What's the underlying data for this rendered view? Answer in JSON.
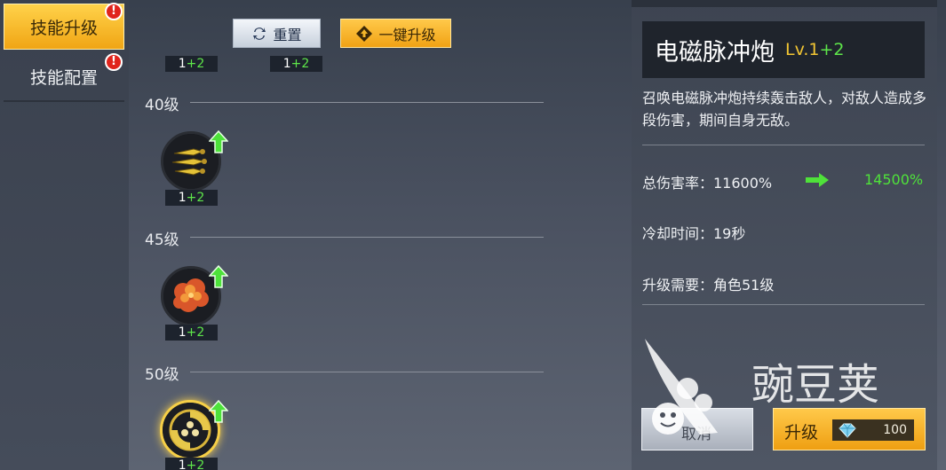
{
  "tabs": [
    {
      "label": "技能升级",
      "active": true,
      "alert": "!"
    },
    {
      "label": "技能配置",
      "active": false,
      "alert": "!"
    }
  ],
  "toolbar": {
    "reset_label": "重置",
    "oneclick_label": "一键升级"
  },
  "top_tags": [
    {
      "base": "1",
      "bonus": "+2"
    },
    {
      "base": "1",
      "bonus": "+2"
    }
  ],
  "rows": [
    {
      "level": "40级",
      "skill": {
        "base": "1",
        "bonus": "+2",
        "selected": false,
        "upgradable": true,
        "icon": "triple-bullet-icon"
      }
    },
    {
      "level": "45级",
      "skill": {
        "base": "1",
        "bonus": "+2",
        "selected": false,
        "upgradable": true,
        "icon": "explosion-icon"
      }
    },
    {
      "level": "50级",
      "skill": {
        "base": "1",
        "bonus": "+2",
        "selected": true,
        "upgradable": true,
        "icon": "electromagnetic-cannon-icon"
      }
    }
  ],
  "detail": {
    "name": "电磁脉冲炮",
    "lv_prefix": "Lv.1",
    "lv_bonus": "+2",
    "description": "召唤电磁脉冲炮持续轰击敌人，对敌人造成多段伤害，期间自身无敌。",
    "stats": {
      "damage_label": "总伤害率：11600%",
      "damage_next": "14500%",
      "cooldown_label": "冷却时间：19秒",
      "requirement_label": "升级需要：角色51级"
    }
  },
  "actions": {
    "grey_label": "取消",
    "upgrade_label": "升级",
    "upgrade_cost": "100"
  },
  "watermark": {
    "text": "豌豆荚"
  },
  "colors": {
    "accent_gold": "#f3b52a",
    "bonus_green": "#5ee64a",
    "alert_red": "#e0241c"
  }
}
